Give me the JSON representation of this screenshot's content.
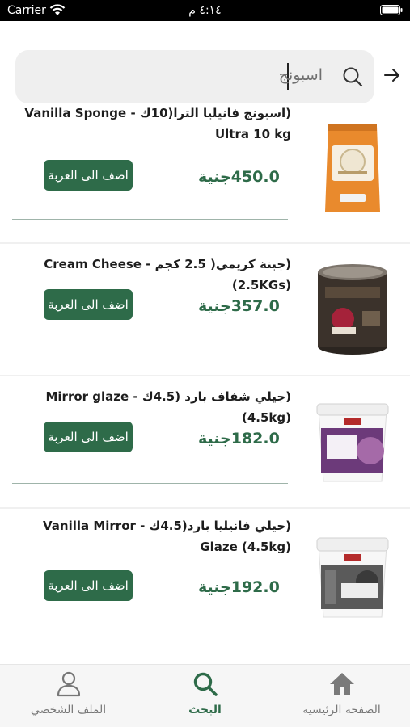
{
  "status_bar": {
    "carrier": "Carrier",
    "time": "٤:١٤ م"
  },
  "search": {
    "query": "اسبونج"
  },
  "products": [
    {
      "title": "(اسبونج فانيليا الترا(10ك - Vanilla Sponge Ultra 10 kg",
      "price": "450.0جنية",
      "button": "اضف الى العربة",
      "image": "flour-bag"
    },
    {
      "title": "(جبنة كريمي( 2.5 كجم - Cream Cheese (2.5KGs)",
      "price": "357.0جنية",
      "button": "اضف الى العربة",
      "image": "cream-cheese-can"
    },
    {
      "title": "(جيلي شفاف بارد (4.5ك - Mirror glaze (4.5kg)",
      "price": "182.0جنية",
      "button": "اضف الى العربة",
      "image": "glaze-bucket-purple"
    },
    {
      "title": "(جيلي فانيليا بارد(4.5ك - Vanilla Mirror Glaze (4.5kg)",
      "price": "192.0جنية",
      "button": "اضف الى العربة",
      "image": "glaze-bucket-grey"
    }
  ],
  "tabs": [
    {
      "label": "الملف الشخصي",
      "icon": "person-icon"
    },
    {
      "label": "البحث",
      "icon": "search-icon"
    },
    {
      "label": "الصفحة الرئيسية",
      "icon": "home-icon"
    }
  ],
  "colors": {
    "accent": "#2e6b49"
  }
}
